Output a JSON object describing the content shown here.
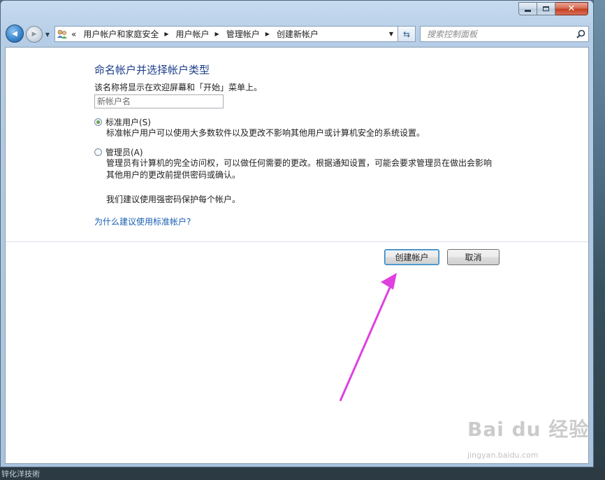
{
  "window": {
    "caption_buttons": {
      "minimize_icon": "minimize-glyph",
      "maximize_icon": "maximize-glyph",
      "close_icon": "close-glyph",
      "close_symbol": "✕"
    }
  },
  "nav": {
    "back_icon": "back-arrow-icon",
    "forward_icon": "forward-arrow-icon",
    "back_symbol": "◀",
    "forward_symbol": "▶",
    "dropdown_symbol": "▼"
  },
  "address": {
    "overflow": "«",
    "icon": "user-accounts-icon",
    "breadcrumbs": [
      {
        "label": "用户帐户和家庭安全"
      },
      {
        "label": "用户帐户"
      },
      {
        "label": "管理帐户"
      },
      {
        "label": "创建新帐户"
      }
    ],
    "separator": "▶",
    "dropdown_symbol": "▼",
    "refresh_symbol": "⇆"
  },
  "search": {
    "placeholder": "搜索控制面板",
    "icon": "search-icon"
  },
  "content": {
    "title": "命名帐户并选择帐户类型",
    "name_description": "该名称将显示在欢迎屏幕和「开始」菜单上。",
    "name_input": {
      "value": "",
      "placeholder": "新帐户名"
    },
    "account_types": [
      {
        "label": "标准用户(S)",
        "checked": true,
        "description": [
          "标准帐户用户可以使用大多数软件以及更改不影响其他用户或计算机安全的系统设置。"
        ]
      },
      {
        "label": "管理员(A)",
        "checked": false,
        "description": [
          "管理员有计算机的完全访问权，可以做任何需要的更改。根据通知设置，可能会要求管理员在做出会影响",
          "其他用户的更改前提供密码或确认。"
        ]
      }
    ],
    "recommendation": "我们建议使用强密码保护每个帐户。",
    "help_link": "为什么建议使用标准帐户?",
    "buttons": {
      "create": "创建帐户",
      "cancel": "取消"
    }
  },
  "annotation": {
    "arrow_color": "#e040e0"
  },
  "watermark": {
    "brand": "Bai du 经验",
    "url": "jingyan.baidu.com"
  },
  "desktop": {
    "bottom_text": "锌化洋技術"
  },
  "colors": {
    "title": "#1e3f8a",
    "link": "#1a5fb4",
    "close_button": "#c43d1e"
  }
}
